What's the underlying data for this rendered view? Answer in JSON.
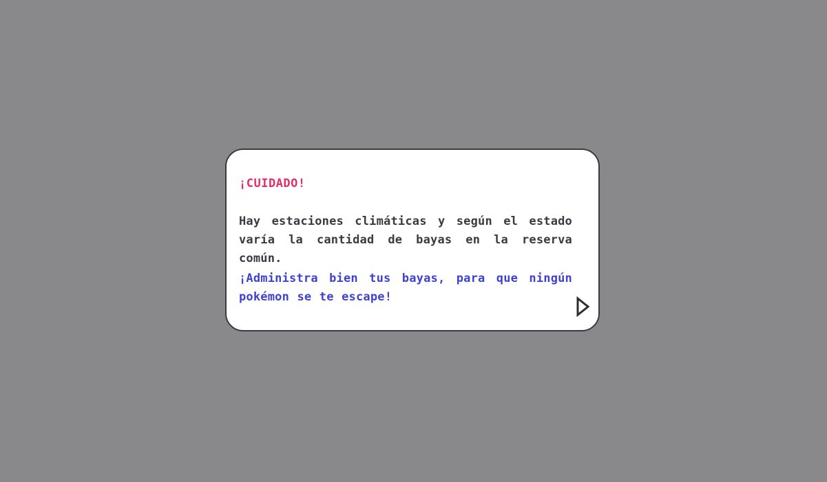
{
  "dialog": {
    "title": "¡CUIDADO!",
    "message": "Hay estaciones climáticas y según el estado varía la cantidad de bayas en la reserva común.",
    "advice": "¡Administra bien tus bayas, para que ningún pokémon se te escape!",
    "next_icon": "play-arrow-outline-icon"
  },
  "colors": {
    "background": "#89898b",
    "dialog_background": "#ffffff",
    "dialog_border": "#3a3a3e",
    "warning_text": "#e0306a",
    "body_text": "#3a3a40",
    "advice_text": "#3e42d2"
  }
}
